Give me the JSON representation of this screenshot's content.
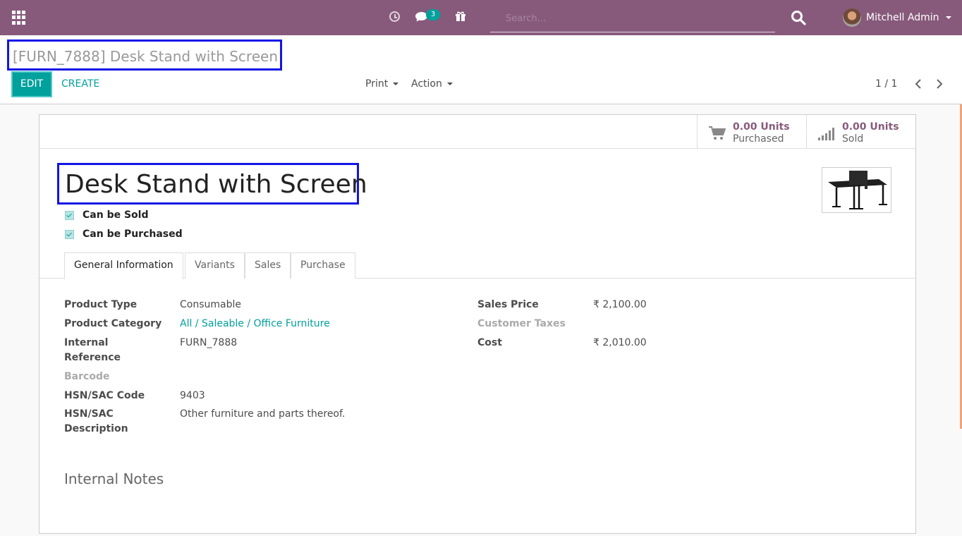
{
  "navbar": {
    "chat_badge": "3",
    "search_placeholder": "Search...",
    "user_name": "Mitchell Admin"
  },
  "control_panel": {
    "breadcrumb": "[FURN_7888] Desk Stand with Screen",
    "edit_label": "EDIT",
    "create_label": "CREATE",
    "print_label": "Print",
    "action_label": "Action",
    "pager": "1 / 1"
  },
  "stat_buttons": [
    {
      "value": "0.00 Units",
      "label": "Purchased",
      "icon": "cart-icon"
    },
    {
      "value": "0.00 Units",
      "label": "Sold",
      "icon": "signal-bars-icon"
    }
  ],
  "product": {
    "name": "Desk Stand with Screen",
    "can_be_sold_label": "Can be Sold",
    "can_be_purchased_label": "Can be Purchased"
  },
  "tabs": [
    "General Information",
    "Variants",
    "Sales",
    "Purchase"
  ],
  "left_fields": {
    "product_type_label": "Product Type",
    "product_type_value": "Consumable",
    "category_label": "Product Category",
    "category_value": "All / Saleable / Office Furniture",
    "internal_ref_label_1": "Internal",
    "internal_ref_label_2": "Reference",
    "internal_ref_value": "FURN_7888",
    "barcode_label": "Barcode",
    "hsn_code_label": "HSN/SAC Code",
    "hsn_code_value": "9403",
    "hsn_desc_label_1": "HSN/SAC",
    "hsn_desc_label_2": "Description",
    "hsn_desc_value": "Other furniture and parts thereof."
  },
  "right_fields": {
    "sales_price_label": "Sales Price",
    "sales_price_value": "₹ 2,100.00",
    "customer_taxes_label": "Customer Taxes",
    "cost_label": "Cost",
    "cost_value": "₹ 2,010.00"
  },
  "notes": {
    "title": "Internal Notes"
  },
  "colors": {
    "navbar": "#875a7b",
    "accent": "#00a09d",
    "highlight_box": "#1414e6"
  }
}
